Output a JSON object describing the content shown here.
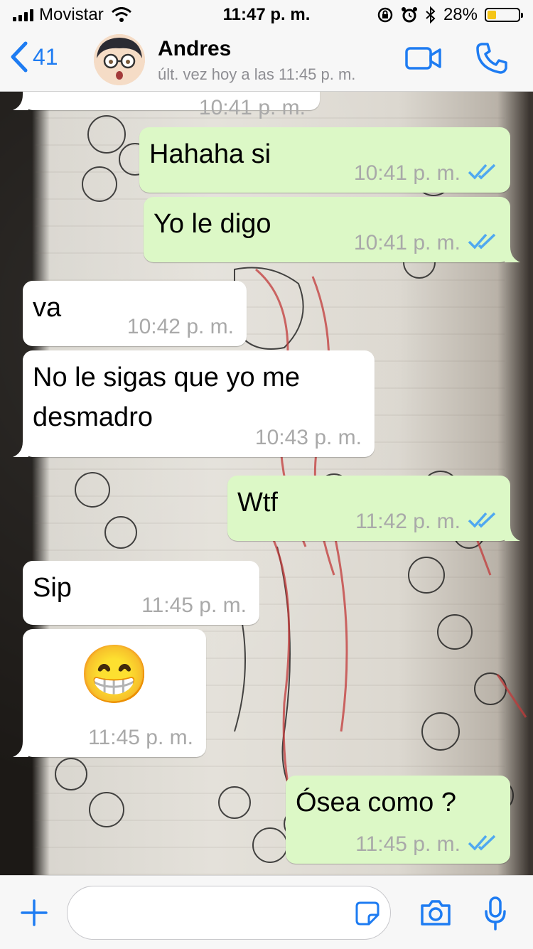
{
  "status_bar": {
    "carrier": "Movistar",
    "time": "11:47 p. m.",
    "battery": "28%",
    "battery_level": 0.28
  },
  "header": {
    "back_count": "41",
    "contact_name": "Andres",
    "contact_status": "últ. vez hoy a las 11:45 p. m."
  },
  "messages": [
    {
      "direction": "in",
      "text": "",
      "time": "10:41 p. m."
    },
    {
      "direction": "out",
      "text": "Hahaha si",
      "time": "10:41 p. m.",
      "status": "read"
    },
    {
      "direction": "out",
      "text": "Yo le digo",
      "time": "10:41 p. m.",
      "status": "read"
    },
    {
      "direction": "in",
      "text": "va",
      "time": "10:42 p. m."
    },
    {
      "direction": "in",
      "text": "No le sigas que yo me desmadro",
      "line1": "No le sigas que yo me",
      "line2": "desmadro",
      "time": "10:43 p. m."
    },
    {
      "direction": "out",
      "text": "Wtf",
      "time": "11:42 p. m.",
      "status": "read"
    },
    {
      "direction": "in",
      "text": "Sip",
      "time": "11:45 p. m."
    },
    {
      "direction": "in",
      "text": "😁",
      "time": "11:45 p. m."
    },
    {
      "direction": "out",
      "text": "Ósea como ?",
      "time": "11:45 p. m.",
      "status": "read"
    }
  ],
  "composer": {
    "value": "",
    "placeholder": ""
  },
  "colors": {
    "accent": "#1e7cf2",
    "outgoing_bubble": "#dcf8c6",
    "incoming_bubble": "#ffffff",
    "read_ticks": "#4fa8f0",
    "timestamp": "#a9a9a9"
  },
  "icons": [
    "back-chevron-icon",
    "video-call-icon",
    "phone-icon",
    "plus-icon",
    "sticker-icon",
    "camera-icon",
    "microphone-icon",
    "wifi-icon",
    "alarm-icon",
    "bluetooth-icon",
    "orientation-lock-icon"
  ]
}
